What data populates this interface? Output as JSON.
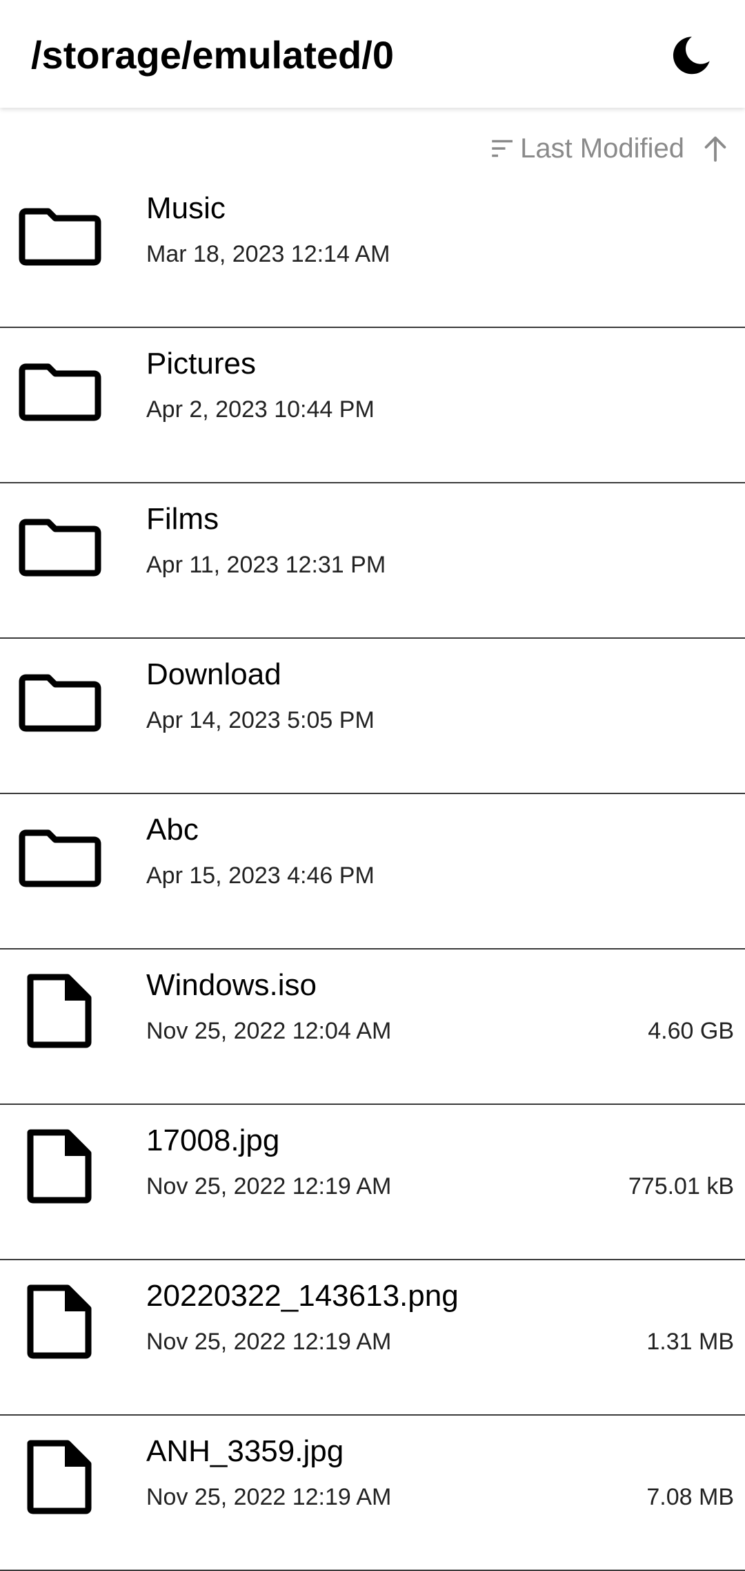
{
  "header": {
    "path": "/storage/emulated/0",
    "theme_icon": "moon-icon"
  },
  "sort": {
    "icon": "sort-icon",
    "label": "Last Modified",
    "direction_icon": "arrow-up-icon"
  },
  "items": [
    {
      "type": "folder",
      "name": "Music",
      "modified": "Mar 18, 2023 12:14 AM",
      "size": ""
    },
    {
      "type": "folder",
      "name": "Pictures",
      "modified": "Apr 2, 2023 10:44 PM",
      "size": ""
    },
    {
      "type": "folder",
      "name": "Films",
      "modified": "Apr 11, 2023 12:31 PM",
      "size": ""
    },
    {
      "type": "folder",
      "name": "Download",
      "modified": "Apr 14, 2023 5:05 PM",
      "size": ""
    },
    {
      "type": "folder",
      "name": "Abc",
      "modified": "Apr 15, 2023 4:46 PM",
      "size": ""
    },
    {
      "type": "file",
      "name": "Windows.iso",
      "modified": "Nov 25, 2022 12:04 AM",
      "size": "4.60 GB"
    },
    {
      "type": "file",
      "name": "17008.jpg",
      "modified": "Nov 25, 2022 12:19 AM",
      "size": "775.01 kB"
    },
    {
      "type": "file",
      "name": "20220322_143613.png",
      "modified": "Nov 25, 2022 12:19 AM",
      "size": "1.31 MB"
    },
    {
      "type": "file",
      "name": "ANH_3359.jpg",
      "modified": "Nov 25, 2022 12:19 AM",
      "size": "7.08 MB"
    }
  ]
}
